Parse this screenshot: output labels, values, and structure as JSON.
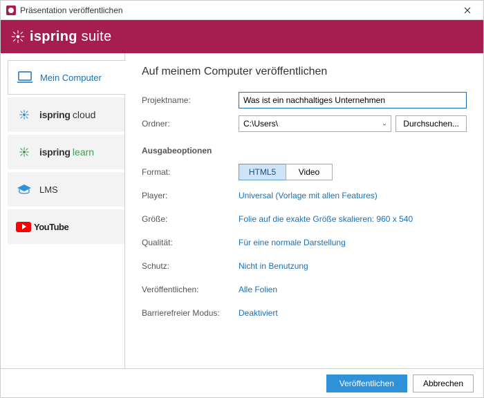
{
  "window": {
    "title": "Präsentation veröffentlichen"
  },
  "brand": {
    "name_bold": "ispring",
    "name_light": " suite"
  },
  "sidebar": {
    "items": [
      {
        "label": "Mein Computer"
      },
      {
        "prefix": "ispring",
        "suffix": "cloud"
      },
      {
        "prefix": "ispring",
        "suffix": "learn"
      },
      {
        "label": "LMS"
      },
      {
        "label": "YouTube"
      }
    ]
  },
  "main": {
    "heading": "Auf meinem Computer veröffentlichen",
    "project_label": "Projektname:",
    "project_value": "Was ist ein nachhaltiges Unternehmen",
    "folder_label": "Ordner:",
    "folder_value": "C:\\Users\\",
    "browse_label": "Durchsuchen...",
    "output_section": "Ausgabeoptionen",
    "format_label": "Format:",
    "format_html5": "HTML5",
    "format_video": "Video",
    "rows": {
      "player": {
        "label": "Player:",
        "value": "Universal (Vorlage mit allen Features)"
      },
      "size": {
        "label": "Größe:",
        "value": "Folie auf die exakte Größe skalieren: 960 x 540"
      },
      "quality": {
        "label": "Qualität:",
        "value": "Für eine normale Darstellung"
      },
      "protect": {
        "label": "Schutz:",
        "value": "Nicht in Benutzung"
      },
      "publish": {
        "label": "Veröffentlichen:",
        "value": "Alle Folien"
      },
      "a11y": {
        "label": "Barrierefreier Modus:",
        "value": "Deaktiviert"
      }
    }
  },
  "footer": {
    "publish": "Veröffentlichen",
    "cancel": "Abbrechen"
  }
}
